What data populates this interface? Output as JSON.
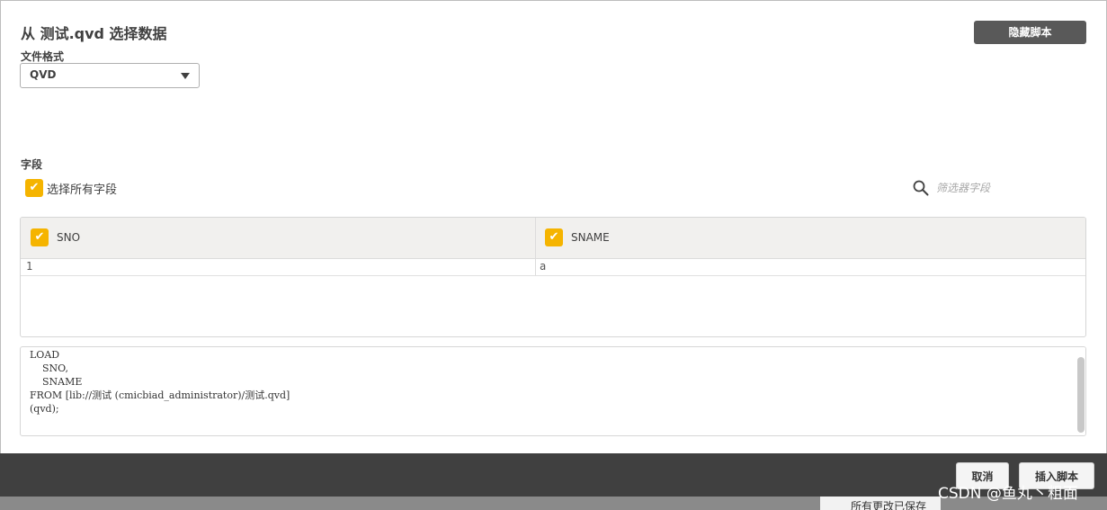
{
  "dialog": {
    "title": "从 测试.qvd 选择数据",
    "hide_script_label": "隐藏脚本",
    "file_format_label": "文件格式",
    "file_format_value": "QVD",
    "fields_label": "字段",
    "select_all_label": "选择所有字段",
    "filter_placeholder": "筛选器字段"
  },
  "table": {
    "columns": [
      {
        "label": "SNO",
        "checked": true
      },
      {
        "label": "SNAME",
        "checked": true
      }
    ],
    "rows": [
      [
        "1",
        "a"
      ]
    ]
  },
  "script": {
    "lines": [
      "LOAD",
      "    SNO,",
      "    SNAME",
      "FROM [lib://测试 (cmicbiad_administrator)/测试.qvd]",
      "(qvd);"
    ]
  },
  "footer": {
    "cancel_label": "取消",
    "insert_label": "插入脚本"
  },
  "background": {
    "status_text": "所有更改已保存"
  },
  "watermark": "CSDN @鱼丸丶粗面",
  "colors": {
    "accent": "#f5b400",
    "footer_bg": "#404040",
    "dark_button": "#595959"
  },
  "icons": {
    "search": "search-icon",
    "check": "check-icon",
    "dropdown": "chevron-down-icon"
  }
}
